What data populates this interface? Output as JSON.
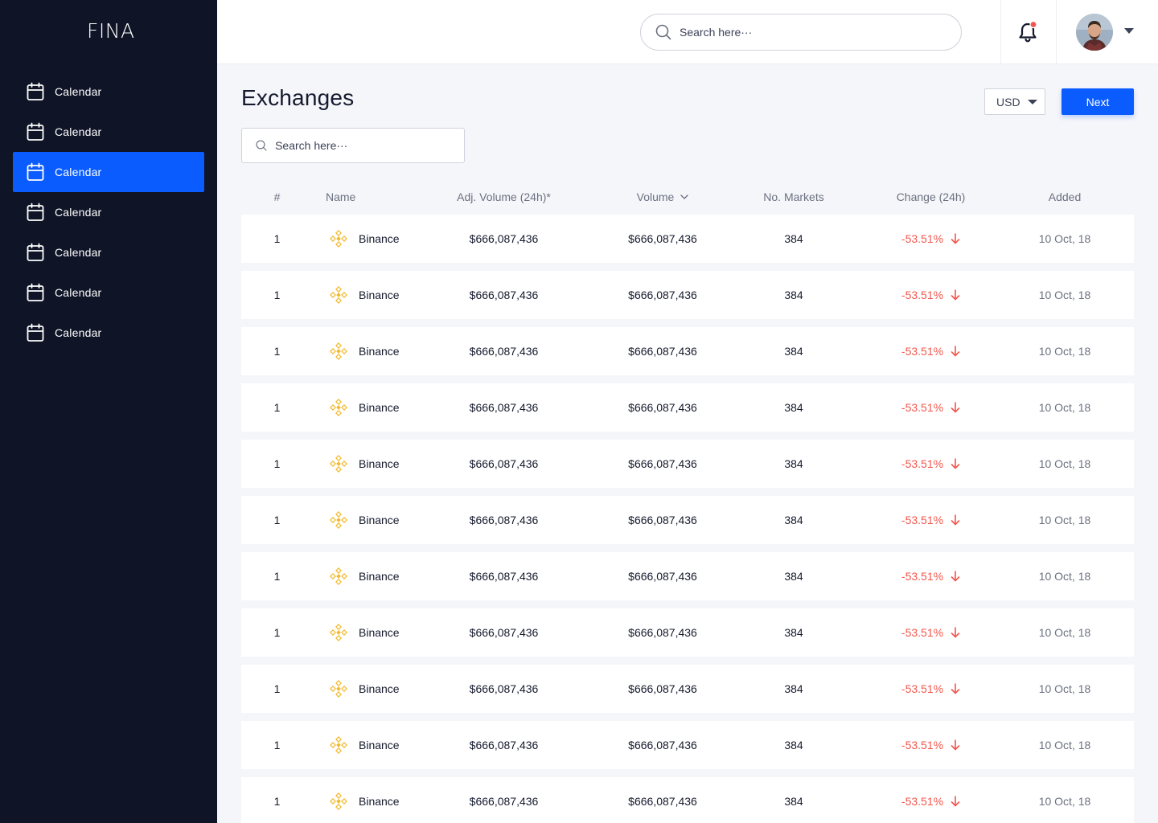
{
  "app": {
    "logo": "FINA"
  },
  "sidebar": {
    "items": [
      {
        "label": "Calendar",
        "icon": "calendar-icon",
        "active": false
      },
      {
        "label": "Calendar",
        "icon": "calendar-icon",
        "active": false
      },
      {
        "label": "Calendar",
        "icon": "calendar-icon",
        "active": true
      },
      {
        "label": "Calendar",
        "icon": "calendar-icon",
        "active": false
      },
      {
        "label": "Calendar",
        "icon": "calendar-icon",
        "active": false
      },
      {
        "label": "Calendar",
        "icon": "calendar-icon",
        "active": false
      },
      {
        "label": "Calendar",
        "icon": "calendar-icon",
        "active": false
      }
    ]
  },
  "header": {
    "search_placeholder": "Search here···",
    "notification_icon": "bell-icon",
    "avatar_icon": "user-avatar"
  },
  "main": {
    "title": "Exchanges",
    "currency": "USD",
    "next_label": "Next",
    "search_placeholder": "Search here···"
  },
  "table": {
    "columns": [
      "#",
      "Name",
      "Adj. Volume (24h)*",
      "Volume",
      "No. Markets",
      "Change (24h)",
      "Added"
    ],
    "rows": [
      {
        "rank": "1",
        "name": "Binance",
        "adj_volume": "$666,087,436",
        "volume": "$666,087,436",
        "markets": "384",
        "change": "-53.51%",
        "added": "10 Oct, 18"
      },
      {
        "rank": "1",
        "name": "Binance",
        "adj_volume": "$666,087,436",
        "volume": "$666,087,436",
        "markets": "384",
        "change": "-53.51%",
        "added": "10 Oct, 18"
      },
      {
        "rank": "1",
        "name": "Binance",
        "adj_volume": "$666,087,436",
        "volume": "$666,087,436",
        "markets": "384",
        "change": "-53.51%",
        "added": "10 Oct, 18"
      },
      {
        "rank": "1",
        "name": "Binance",
        "adj_volume": "$666,087,436",
        "volume": "$666,087,436",
        "markets": "384",
        "change": "-53.51%",
        "added": "10 Oct, 18"
      },
      {
        "rank": "1",
        "name": "Binance",
        "adj_volume": "$666,087,436",
        "volume": "$666,087,436",
        "markets": "384",
        "change": "-53.51%",
        "added": "10 Oct, 18"
      },
      {
        "rank": "1",
        "name": "Binance",
        "adj_volume": "$666,087,436",
        "volume": "$666,087,436",
        "markets": "384",
        "change": "-53.51%",
        "added": "10 Oct, 18"
      },
      {
        "rank": "1",
        "name": "Binance",
        "adj_volume": "$666,087,436",
        "volume": "$666,087,436",
        "markets": "384",
        "change": "-53.51%",
        "added": "10 Oct, 18"
      },
      {
        "rank": "1",
        "name": "Binance",
        "adj_volume": "$666,087,436",
        "volume": "$666,087,436",
        "markets": "384",
        "change": "-53.51%",
        "added": "10 Oct, 18"
      },
      {
        "rank": "1",
        "name": "Binance",
        "adj_volume": "$666,087,436",
        "volume": "$666,087,436",
        "markets": "384",
        "change": "-53.51%",
        "added": "10 Oct, 18"
      },
      {
        "rank": "1",
        "name": "Binance",
        "adj_volume": "$666,087,436",
        "volume": "$666,087,436",
        "markets": "384",
        "change": "-53.51%",
        "added": "10 Oct, 18"
      },
      {
        "rank": "1",
        "name": "Binance",
        "adj_volume": "$666,087,436",
        "volume": "$666,087,436",
        "markets": "384",
        "change": "-53.51%",
        "added": "10 Oct, 18"
      }
    ]
  },
  "colors": {
    "sidebar_bg": "#0f1427",
    "accent": "#0b5cff",
    "negative": "#f2574d",
    "coin": "#f3ba2f"
  }
}
